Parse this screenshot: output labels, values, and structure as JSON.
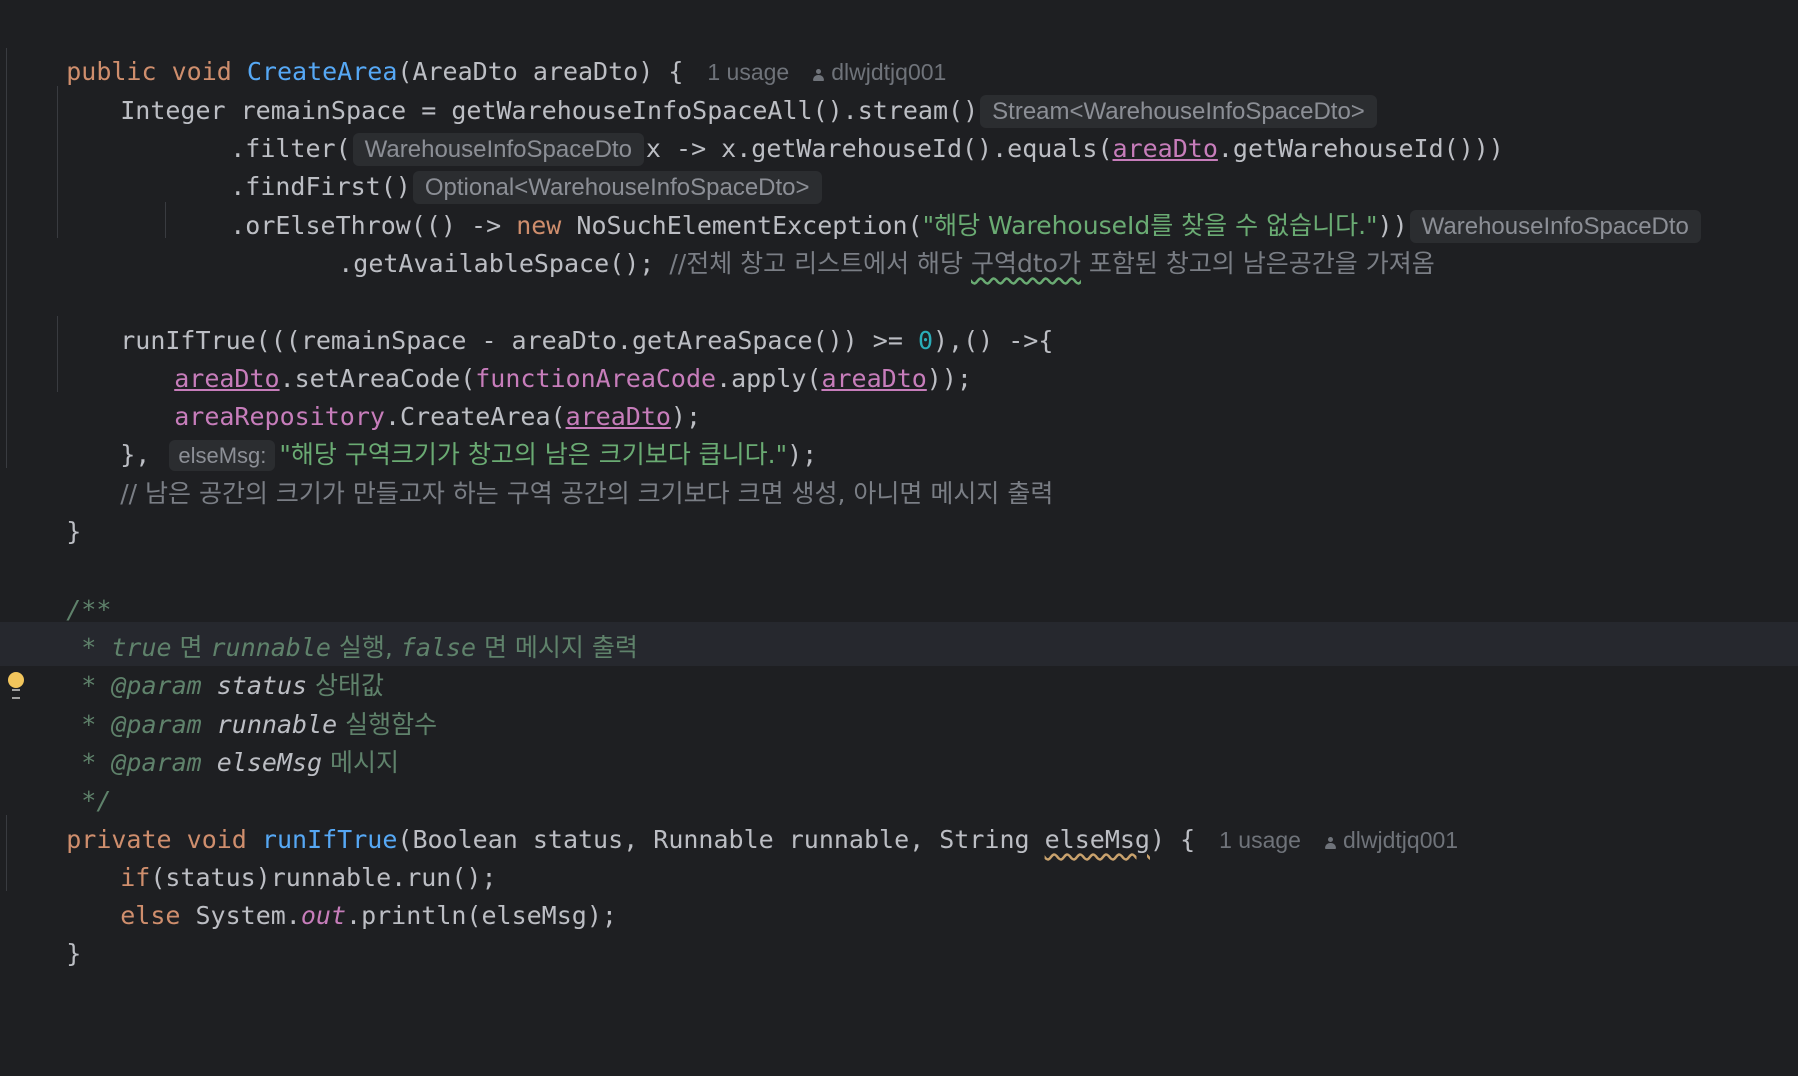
{
  "editor": {
    "lines": {
      "l1": {
        "kw1": "public",
        "kw2": "void",
        "name": "CreateArea",
        "rest": "(AreaDto areaDto) {",
        "usages": "1 usage",
        "author": "dlwjdtjq001"
      },
      "l2": {
        "code": "Integer remainSpace = getWarehouseInfoSpaceAll().stream()",
        "hint": "Stream<WarehouseInfoSpaceDto>"
      },
      "l3": {
        "pre": ".filter(",
        "hint": "WarehouseInfoSpaceDto",
        "mid": "x -> x.getWarehouseId().equals(",
        "var": "areaDto",
        "post": ".getWarehouseId()))"
      },
      "l4": {
        "code": ".findFirst()",
        "hint": "Optional<WarehouseInfoSpaceDto>"
      },
      "l5": {
        "pre": ".orElseThrow(() -> ",
        "kw": "new",
        "mid": " NoSuchElementException(",
        "str": "\"해당 WarehouseId를 찾을 수 없습니다.\"",
        "post": "))",
        "hint": "WarehouseInfoSpaceDto"
      },
      "l6": {
        "code": ".getAvailableSpace(); ",
        "cmt1": "//전체 창고 리스트에서 해당 ",
        "cmt_sq": "구역dto가",
        "cmt2": " 포함된 창고의 남은공간을 가져옴"
      },
      "l8": {
        "pre": "runIfTrue(((remainSpace - areaDto.getAreaSpace()) >= ",
        "num": "0",
        "post": "),() ->{"
      },
      "l9": {
        "v1": "areaDto",
        "m1": ".setAreaCode(",
        "f1": "functionAreaCode",
        "m2": ".apply(",
        "v2": "areaDto",
        "post": "));"
      },
      "l10": {
        "f": "areaRepository",
        "m": ".CreateArea(",
        "v": "areaDto",
        "post": ");"
      },
      "l11": {
        "pre": "}, ",
        "hint": "elseMsg:",
        "str": "\"해당 구역크기가 창고의 남은 크기보다 큽니다.\"",
        "post": ");"
      },
      "l12": {
        "cmt": "// 남은 공간의 크기가 만들고자 하는 구역 공간의 크기보다 크면 생성, 아니면 메시지 출력"
      },
      "l13": {
        "code": "}"
      },
      "l15": {
        "code": "/**"
      },
      "l16": {
        "star": " * ",
        "w1": "true",
        "k1": " 면 ",
        "w2": "runnable",
        "k2": " 실행, ",
        "w3": "false",
        "k3": " 면 메시지 출력"
      },
      "l17": {
        "star": " * ",
        "tag": "@param",
        "name": " status",
        "desc": " 상태값"
      },
      "l18": {
        "star": " * ",
        "tag": "@param",
        "name": " runnable",
        "desc": " 실행함수"
      },
      "l19": {
        "star": " * ",
        "tag": "@param",
        "name": " elseMsg",
        "desc": " 메시지"
      },
      "l20": {
        "code": " */"
      },
      "l21": {
        "kw1": "private",
        "kw2": "void",
        "name": "runIfTrue",
        "pre": "(Boolean status, Runnable runnable, String ",
        "sq": "elseMsg",
        "post": ") {",
        "usages": "1 usage",
        "author": "dlwjdtjq001"
      },
      "l22": {
        "kw": "if",
        "rest": "(status)runnable.run();"
      },
      "l23": {
        "kw": "else",
        "pre": " System.",
        "stat": "out",
        "post": ".println(elseMsg);"
      },
      "l24": {
        "code": "}"
      }
    }
  }
}
